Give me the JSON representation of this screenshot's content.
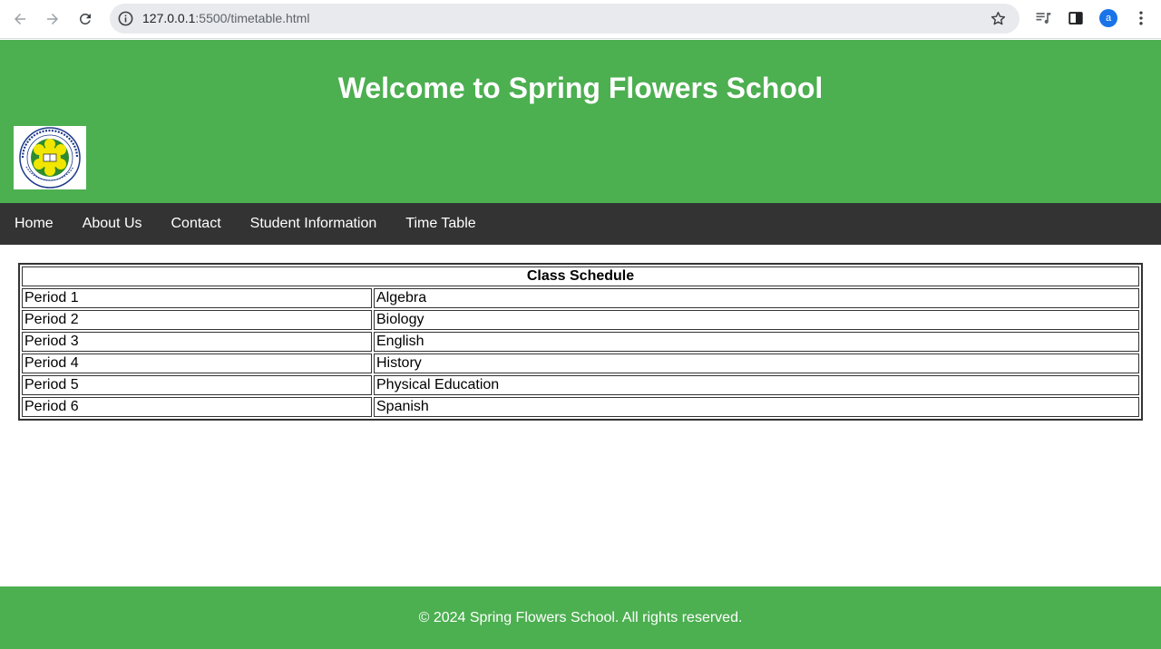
{
  "browser": {
    "url_host": "127.0.0.1",
    "url_rest": ":5500/timetable.html",
    "profile_initial": "a",
    "icons": [
      "back-icon",
      "forward-icon",
      "reload-icon",
      "site-info-icon",
      "bookmark-star-icon",
      "media-controls-icon",
      "side-panel-icon",
      "kebab-menu-icon"
    ]
  },
  "header": {
    "title": "Welcome to Spring Flowers School",
    "logo_text": "SPRINGFLOWERS INTERNATIONAL SCHOOL",
    "background": "#4caf50"
  },
  "nav": {
    "items": [
      {
        "label": "Home"
      },
      {
        "label": "About Us"
      },
      {
        "label": "Contact"
      },
      {
        "label": "Student Information"
      },
      {
        "label": "Time Table"
      }
    ],
    "background": "#333333"
  },
  "schedule": {
    "caption": "Class Schedule",
    "rows": [
      {
        "period": "Period 1",
        "subject": "Algebra"
      },
      {
        "period": "Period 2",
        "subject": "Biology"
      },
      {
        "period": "Period 3",
        "subject": "English"
      },
      {
        "period": "Period 4",
        "subject": "History"
      },
      {
        "period": "Period 5",
        "subject": "Physical Education"
      },
      {
        "period": "Period 6",
        "subject": "Spanish"
      }
    ]
  },
  "footer": {
    "text": "© 2024 Spring Flowers School. All rights reserved."
  }
}
